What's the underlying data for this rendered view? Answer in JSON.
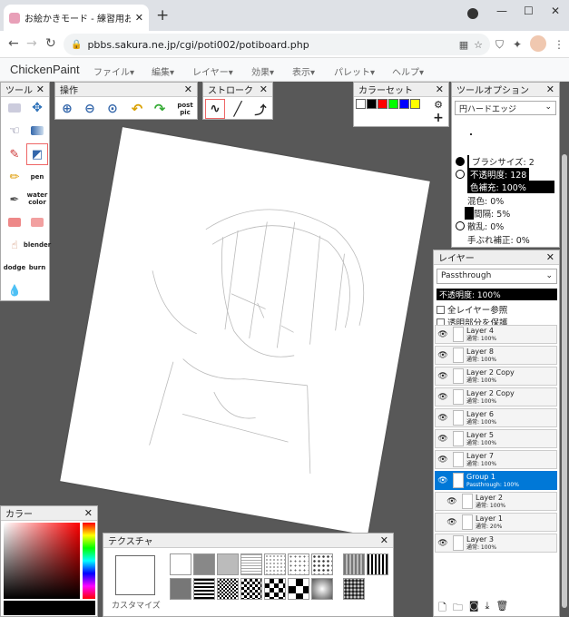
{
  "browser": {
    "tab_title": "お絵かきモード - 練習用お絵かき掲示",
    "tab_close": "✕",
    "new_tab": "+",
    "url": "pbbs.sakura.ne.jp/cgi/poti002/potiboard.php"
  },
  "app": {
    "name": "ChickenPaint",
    "menus": [
      "ファイル",
      "編集",
      "レイヤー",
      "効果",
      "表示",
      "パレット",
      "ヘルプ"
    ]
  },
  "tools": {
    "title": "ツール",
    "close": "✕",
    "pen": "pen",
    "watercolor": "water color",
    "blender": "blender",
    "dodge": "dodge",
    "burn": "burn"
  },
  "ops": {
    "title": "操作",
    "close": "✕",
    "post": "post pic"
  },
  "stroke": {
    "title": "ストローク",
    "close": "✕"
  },
  "swatches": {
    "title": "カラーセット",
    "close": "✕",
    "colors": [
      "#ffffff",
      "#000000",
      "#ff0000",
      "#00ff00",
      "#0000ff",
      "#ffff00"
    ]
  },
  "tool_options": {
    "title": "ツールオプション",
    "close": "✕",
    "brush": "円ハードエッジ",
    "brush_size": "ブラシサイズ: 2",
    "opacity": "不透明度: 128",
    "color_fill": "色補充: 100%",
    "mix": "混色: 0%",
    "spacing": "間隔: 5%",
    "scatter": "散乱: 0%",
    "smoothing": "手ぶれ補正: 0%"
  },
  "layers": {
    "title": "レイヤー",
    "close": "✕",
    "blend": "Passthrough",
    "opacity": "不透明度: 100%",
    "sample_all": "全レイヤー参照",
    "lock_alpha": "透明部分を保護",
    "items": [
      {
        "name": "Layer 4",
        "mode": "通常: 100%"
      },
      {
        "name": "Layer 8",
        "mode": "通常: 100%"
      },
      {
        "name": "Layer 2 Copy",
        "mode": "通常: 100%"
      },
      {
        "name": "Layer 2 Copy",
        "mode": "通常: 100%"
      },
      {
        "name": "Layer 6",
        "mode": "通常: 100%"
      },
      {
        "name": "Layer 5",
        "mode": "通常: 100%"
      },
      {
        "name": "Layer 7",
        "mode": "通常: 100%"
      },
      {
        "name": "Group 1",
        "mode": "Passthrough: 100%"
      },
      {
        "name": "Layer 2",
        "mode": "通常: 100%"
      },
      {
        "name": "Layer 1",
        "mode": "通常: 20%"
      },
      {
        "name": "Layer 3",
        "mode": "通常: 100%"
      }
    ]
  },
  "color": {
    "title": "カラー",
    "close": "✕"
  },
  "texture": {
    "title": "テクスチャ",
    "close": "✕",
    "customize": "カスタマイズ"
  }
}
